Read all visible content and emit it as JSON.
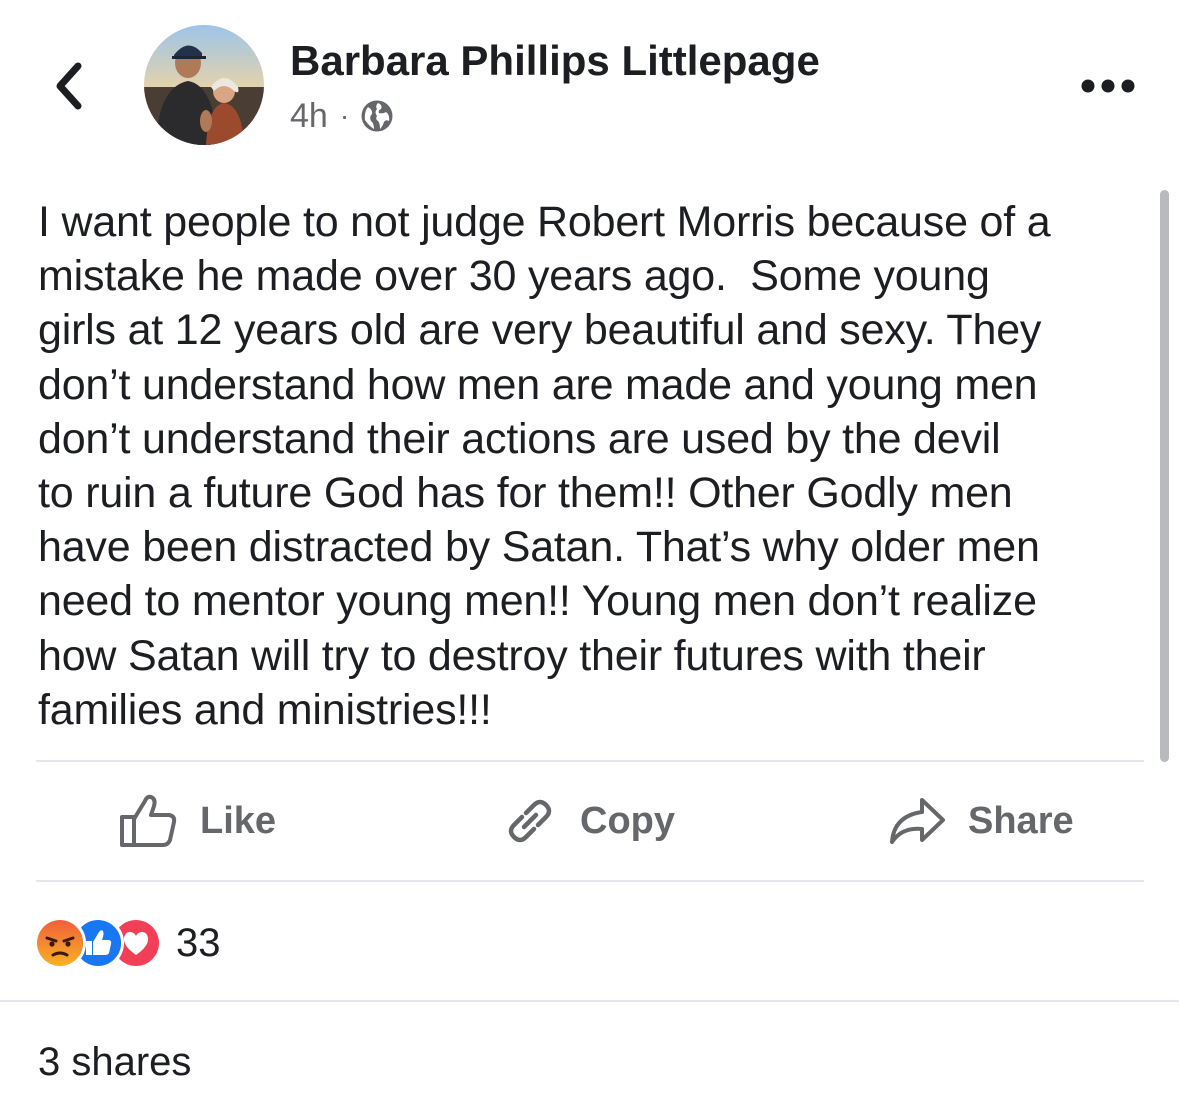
{
  "header": {
    "author_name": "Barbara Phillips Littlepage",
    "timestamp": "4h",
    "separator": "·",
    "audience_icon": "globe-icon"
  },
  "post": {
    "text": "I want people to not judge Robert Morris because of a\nmistake he made over 30 years ago.  Some young\ngirls at 12 years old are very beautiful and sexy. They\ndon’t understand how men are made and young men\ndon’t understand their actions are used by the devil\nto ruin a future God has for them!! Other Godly men\nhave been distracted by Satan. That’s why older men\nneed to mentor young men!! Young men don’t realize\nhow Satan will try to destroy their futures with their\nfamilies and ministries!!!"
  },
  "actions": {
    "like_label": "Like",
    "copy_label": "Copy",
    "share_label": "Share"
  },
  "reactions": {
    "icons": [
      "angry-reaction-icon",
      "like-reaction-icon",
      "love-reaction-icon"
    ],
    "count": "33"
  },
  "footer": {
    "shares": "3 shares"
  },
  "colors": {
    "text": "#1c1e21",
    "secondary": "#65676b",
    "divider": "#e4e6eb",
    "like_blue": "#1877f2",
    "love_red": "#f33e58",
    "angry_orange": "#e9710f"
  }
}
